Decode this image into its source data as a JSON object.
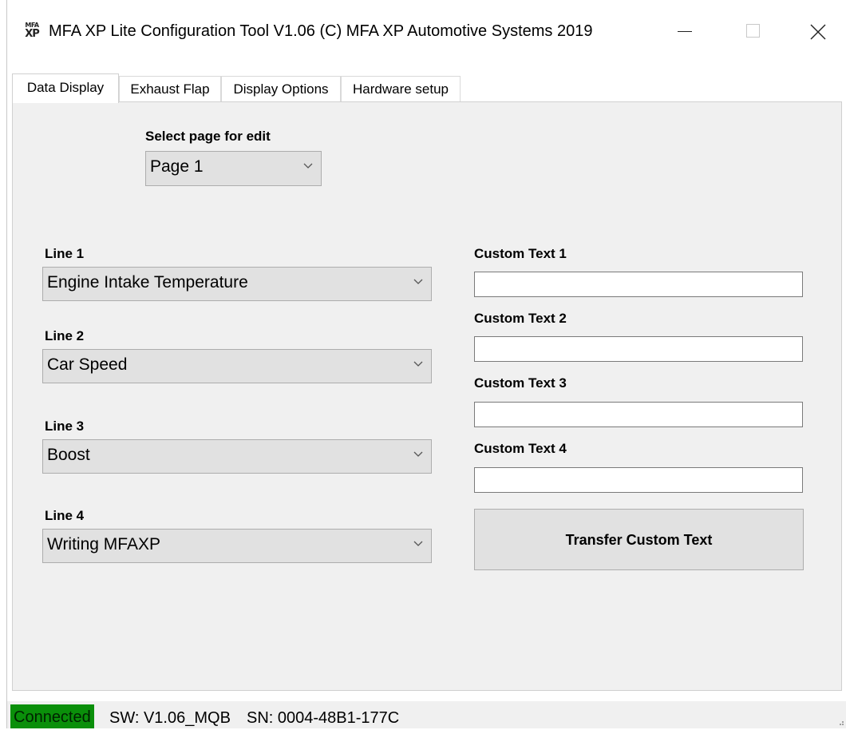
{
  "window": {
    "title": "MFA XP Lite Configuration Tool V1.06  (C) MFA XP Automotive Systems 2019",
    "logo_top": "MFA",
    "logo_bottom": "XP"
  },
  "tabs": [
    {
      "label": "Data Display",
      "active": true
    },
    {
      "label": "Exhaust Flap",
      "active": false
    },
    {
      "label": "Display Options",
      "active": false
    },
    {
      "label": "Hardware setup",
      "active": false
    }
  ],
  "page_select": {
    "label": "Select page for edit",
    "value": "Page 1"
  },
  "lines": [
    {
      "label": "Line 1",
      "value": "Engine Intake Temperature"
    },
    {
      "label": "Line 2",
      "value": "Car Speed"
    },
    {
      "label": "Line 3",
      "value": "Boost"
    },
    {
      "label": "Line 4",
      "value": "Writing MFAXP"
    }
  ],
  "custom_texts": [
    {
      "label": "Custom Text 1",
      "value": ""
    },
    {
      "label": "Custom Text 2",
      "value": ""
    },
    {
      "label": "Custom Text 3",
      "value": ""
    },
    {
      "label": "Custom Text 4",
      "value": ""
    }
  ],
  "transfer_button": "Transfer Custom Text",
  "status": {
    "connection": "Connected",
    "connection_color": "#0a8f0a",
    "software": "SW: V1.06_MQB",
    "serial": "SN: 0004-48B1-177C"
  }
}
